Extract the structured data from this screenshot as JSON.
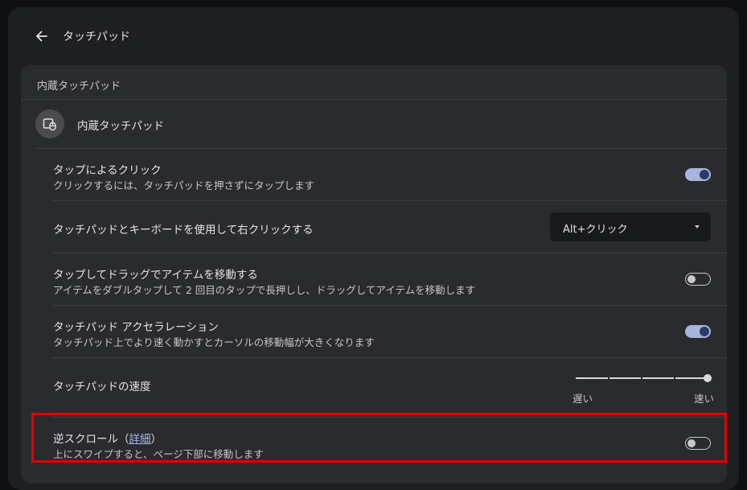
{
  "header": {
    "title": "タッチパッド"
  },
  "section": {
    "title": "内蔵タッチパッド",
    "device_label": "内蔵タッチパッド"
  },
  "settings": {
    "tap_click": {
      "title": "タップによるクリック",
      "subtitle": "クリックするには、タッチパッドを押さずにタップします",
      "enabled": true
    },
    "right_click": {
      "title": "タッチパッドとキーボードを使用して右クリックする",
      "dropdown_value": "Alt+クリック"
    },
    "tap_drag": {
      "title": "タップしてドラッグでアイテムを移動する",
      "subtitle": "アイテムをダブルタップして 2 回目のタップで長押しし、ドラッグしてアイテムを移動します",
      "enabled": false
    },
    "acceleration": {
      "title": "タッチパッド アクセラレーション",
      "subtitle": "タッチパッド上でより速く動かすとカーソルの移動幅が大きくなります",
      "enabled": true
    },
    "speed": {
      "title": "タッチパッドの速度",
      "min_label": "遅い",
      "max_label": "速い",
      "level": 1.0
    },
    "reverse_scroll": {
      "title_prefix": "逆スクロール（",
      "link_text": "詳細",
      "title_suffix": "）",
      "subtitle": "上にスワイプすると、ページ下部に移動します",
      "enabled": false
    }
  },
  "colors": {
    "background": "#1e1f22",
    "card": "#2a2b2e",
    "toggle_on": "#a8b4dc",
    "highlight": "#e10000"
  },
  "icons": {
    "back": "arrow-left-icon",
    "device": "touchpad-icon"
  }
}
